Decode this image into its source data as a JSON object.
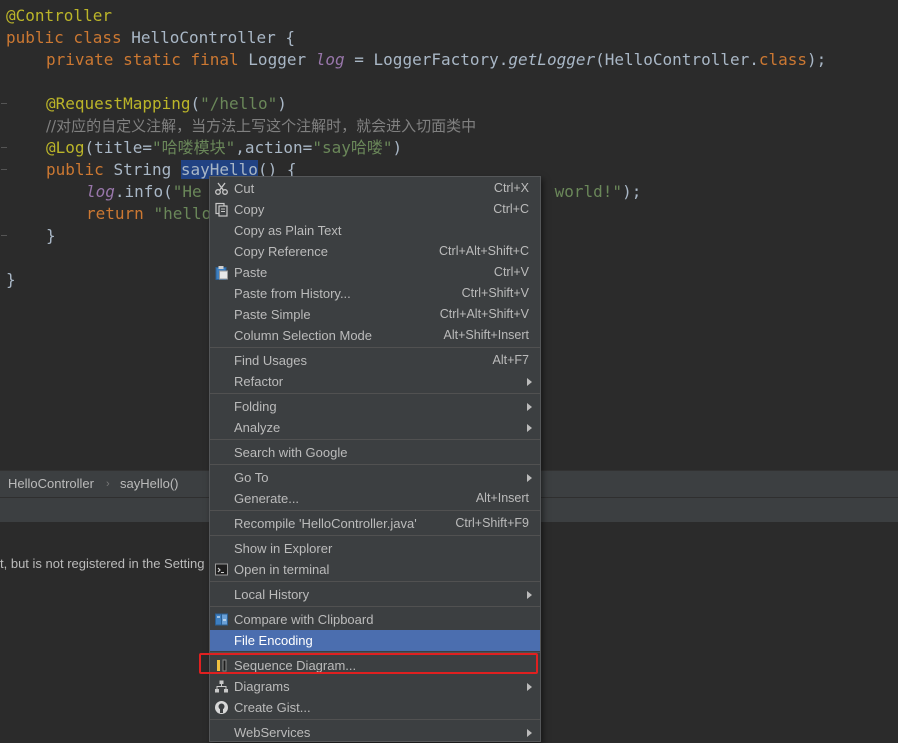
{
  "editor": {
    "lines": {
      "l1": {
        "ann": "@Controller"
      },
      "l2": {
        "kw": "public class ",
        "name": "HelloController {"
      },
      "l3": {
        "kw": "private static final ",
        "type": "Logger ",
        "field": "log",
        "eq": " = LoggerFactory.",
        "method": "getLogger",
        "arg": "(HelloController.",
        "cls": "class",
        "end": ");"
      },
      "l5": {
        "ann": "@RequestMapping",
        "p1": "(",
        "str": "\"/hello\"",
        "p2": ")"
      },
      "l6": {
        "comment": "//对应的自定义注解，当方法上写这个注解时，就会进入切面类中"
      },
      "l7": {
        "ann": "@Log",
        "p1": "(title=",
        "str1": "\"哈喽模块\"",
        "p2": ",action=",
        "str2": "\"say哈喽\"",
        "p3": ")"
      },
      "l8": {
        "kw": "public ",
        "type": "String ",
        "sel": "sayHello",
        "end": "() {"
      },
      "l9": {
        "field": "log",
        "call": ".info(",
        "str_a": "\"He",
        "str_b": " world!\"",
        "end": ");"
      },
      "l10": {
        "kw": "return ",
        "str": "\"hello"
      },
      "l11": {
        "brace": "}"
      },
      "l13": {
        "brace": "}"
      }
    }
  },
  "breadcrumb": {
    "items": [
      "HelloController",
      "sayHello()"
    ]
  },
  "notice": {
    "text": "t, but is not registered in the Setting"
  },
  "menu": {
    "items": [
      {
        "label": "Cut",
        "shortcut": "Ctrl+X",
        "icon": "scissors-icon"
      },
      {
        "label": "Copy",
        "shortcut": "Ctrl+C",
        "icon": "copy-icon"
      },
      {
        "label": "Copy as Plain Text",
        "shortcut": ""
      },
      {
        "label": "Copy Reference",
        "shortcut": "Ctrl+Alt+Shift+C"
      },
      {
        "label": "Paste",
        "shortcut": "Ctrl+V",
        "icon": "clipboard-icon"
      },
      {
        "label": "Paste from History...",
        "shortcut": "Ctrl+Shift+V"
      },
      {
        "label": "Paste Simple",
        "shortcut": "Ctrl+Alt+Shift+V"
      },
      {
        "label": "Column Selection Mode",
        "shortcut": "Alt+Shift+Insert"
      },
      {
        "label": "Find Usages",
        "shortcut": "Alt+F7"
      },
      {
        "label": "Refactor",
        "submenu": true
      },
      {
        "label": "Folding",
        "submenu": true
      },
      {
        "label": "Analyze",
        "submenu": true
      },
      {
        "label": "Search with Google",
        "shortcut": ""
      },
      {
        "label": "Go To",
        "submenu": true
      },
      {
        "label": "Generate...",
        "shortcut": "Alt+Insert"
      },
      {
        "label": "Recompile 'HelloController.java'",
        "shortcut": "Ctrl+Shift+F9"
      },
      {
        "label": "Show in Explorer",
        "shortcut": ""
      },
      {
        "label": "Open in terminal",
        "shortcut": "",
        "icon": "terminal-icon"
      },
      {
        "label": "Local History",
        "submenu": true
      },
      {
        "label": "Compare with Clipboard",
        "shortcut": "",
        "icon": "compare-icon"
      },
      {
        "label": "File Encoding",
        "shortcut": "",
        "highlighted": true
      },
      {
        "label": "Sequence Diagram...",
        "shortcut": "",
        "icon": "sequence-diagram-icon"
      },
      {
        "label": "Diagrams",
        "submenu": true,
        "icon": "diagram-tree-icon"
      },
      {
        "label": "Create Gist...",
        "shortcut": "",
        "icon": "github-icon"
      },
      {
        "label": "WebServices",
        "submenu": true
      }
    ]
  },
  "colors": {
    "highlight": "#4b6eaf",
    "annotation": "#bbb529",
    "keyword": "#cc7832",
    "string": "#6a8759",
    "callout": "#e02020"
  }
}
